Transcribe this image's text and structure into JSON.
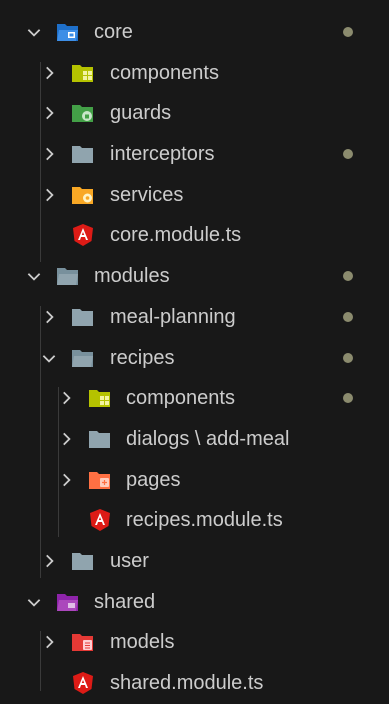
{
  "colors": {
    "background": "#181818",
    "text": "#cccccc",
    "modified_dot": "#8b8b6e",
    "angular_red": "#dd1b16"
  },
  "explorer": {
    "rows": [
      {
        "label": "core",
        "icon": "core-folder-open-icon",
        "chevron": "expanded",
        "modified": true
      },
      {
        "label": "components",
        "icon": "components-folder-icon",
        "chevron": "collapsed",
        "modified": false
      },
      {
        "label": "guards",
        "icon": "guards-folder-icon",
        "chevron": "collapsed",
        "modified": false
      },
      {
        "label": "interceptors",
        "icon": "folder-icon",
        "chevron": "collapsed",
        "modified": true
      },
      {
        "label": "services",
        "icon": "services-folder-icon",
        "chevron": "collapsed",
        "modified": false
      },
      {
        "label": "core.module.ts",
        "icon": "angular-icon",
        "chevron": "none",
        "modified": false
      },
      {
        "label": "modules",
        "icon": "folder-open-icon",
        "chevron": "expanded",
        "modified": true
      },
      {
        "label": "meal-planning",
        "icon": "folder-icon",
        "chevron": "collapsed",
        "modified": true
      },
      {
        "label": "recipes",
        "icon": "folder-open-icon",
        "chevron": "expanded",
        "modified": true
      },
      {
        "label": "components",
        "icon": "components-folder-icon",
        "chevron": "collapsed",
        "modified": true
      },
      {
        "label": "dialogs \\ add-meal",
        "icon": "folder-icon",
        "chevron": "collapsed",
        "modified": false
      },
      {
        "label": "pages",
        "icon": "pages-folder-icon",
        "chevron": "collapsed",
        "modified": false
      },
      {
        "label": "recipes.module.ts",
        "icon": "angular-icon",
        "chevron": "none",
        "modified": false
      },
      {
        "label": "user",
        "icon": "folder-icon",
        "chevron": "collapsed",
        "modified": false
      },
      {
        "label": "shared",
        "icon": "shared-folder-open-icon",
        "chevron": "expanded",
        "modified": false
      },
      {
        "label": "models",
        "icon": "models-folder-icon",
        "chevron": "collapsed",
        "modified": false
      },
      {
        "label": "shared.module.ts",
        "icon": "angular-icon",
        "chevron": "none",
        "modified": false
      }
    ]
  }
}
